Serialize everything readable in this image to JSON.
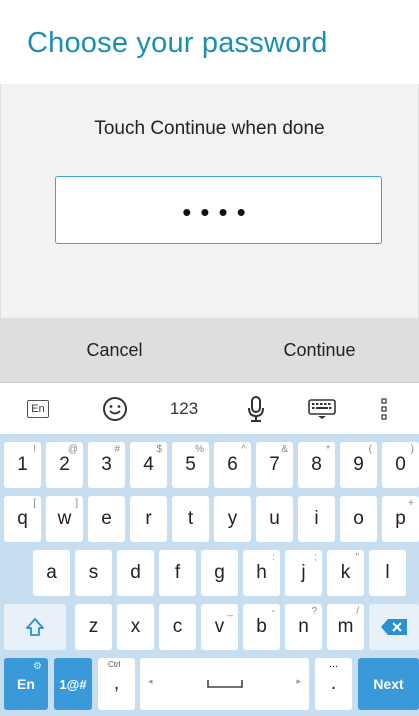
{
  "screen": {
    "title": "Choose your password",
    "subtitle": "Touch Continue when done",
    "password_mask": "••••",
    "accent_color": "#1b8fb0"
  },
  "actions": {
    "cancel_label": "Cancel",
    "continue_label": "Continue"
  },
  "keyboard_toolbar": {
    "language_label": "En",
    "numbers_label": "123",
    "icons": [
      "language-icon",
      "emoji-icon",
      "microphone-icon",
      "keyboard-layout-icon",
      "more-vertical-icon"
    ]
  },
  "keyboard": {
    "row1": [
      {
        "main": "1",
        "sec": "!"
      },
      {
        "main": "2",
        "sec": "@"
      },
      {
        "main": "3",
        "sec": "#"
      },
      {
        "main": "4",
        "sec": "$"
      },
      {
        "main": "5",
        "sec": "%"
      },
      {
        "main": "6",
        "sec": "^"
      },
      {
        "main": "7",
        "sec": "&"
      },
      {
        "main": "8",
        "sec": "*"
      },
      {
        "main": "9",
        "sec": "("
      },
      {
        "main": "0",
        "sec": ")"
      }
    ],
    "row2": [
      {
        "main": "q",
        "sec": "["
      },
      {
        "main": "w",
        "sec": "]"
      },
      {
        "main": "e",
        "sec": ""
      },
      {
        "main": "r",
        "sec": ""
      },
      {
        "main": "t",
        "sec": ""
      },
      {
        "main": "y",
        "sec": ""
      },
      {
        "main": "u",
        "sec": ""
      },
      {
        "main": "i",
        "sec": ""
      },
      {
        "main": "o",
        "sec": ""
      },
      {
        "main": "p",
        "sec": "+"
      }
    ],
    "row3": [
      {
        "main": "a",
        "sec": ""
      },
      {
        "main": "s",
        "sec": ""
      },
      {
        "main": "d",
        "sec": ""
      },
      {
        "main": "f",
        "sec": ""
      },
      {
        "main": "g",
        "sec": ""
      },
      {
        "main": "h",
        "sec": ":"
      },
      {
        "main": "j",
        "sec": ";"
      },
      {
        "main": "k",
        "sec": "\""
      },
      {
        "main": "l",
        "sec": ""
      }
    ],
    "row4": [
      {
        "main": "z",
        "sec": ""
      },
      {
        "main": "x",
        "sec": ""
      },
      {
        "main": "c",
        "sec": ""
      },
      {
        "main": "v",
        "sec": "_"
      },
      {
        "main": "b",
        "sec": "-"
      },
      {
        "main": "n",
        "sec": "?"
      },
      {
        "main": "m",
        "sec": "/"
      }
    ],
    "bottom": {
      "lang_label": "En",
      "symbols_label": "1@#",
      "ctrl_label": "Ctrl",
      "comma_label": ",",
      "period_label": ".",
      "ellipsis_label": "...",
      "next_label": "Next"
    },
    "key_color": "#3a9ad9",
    "background_color": "#c6def0"
  }
}
